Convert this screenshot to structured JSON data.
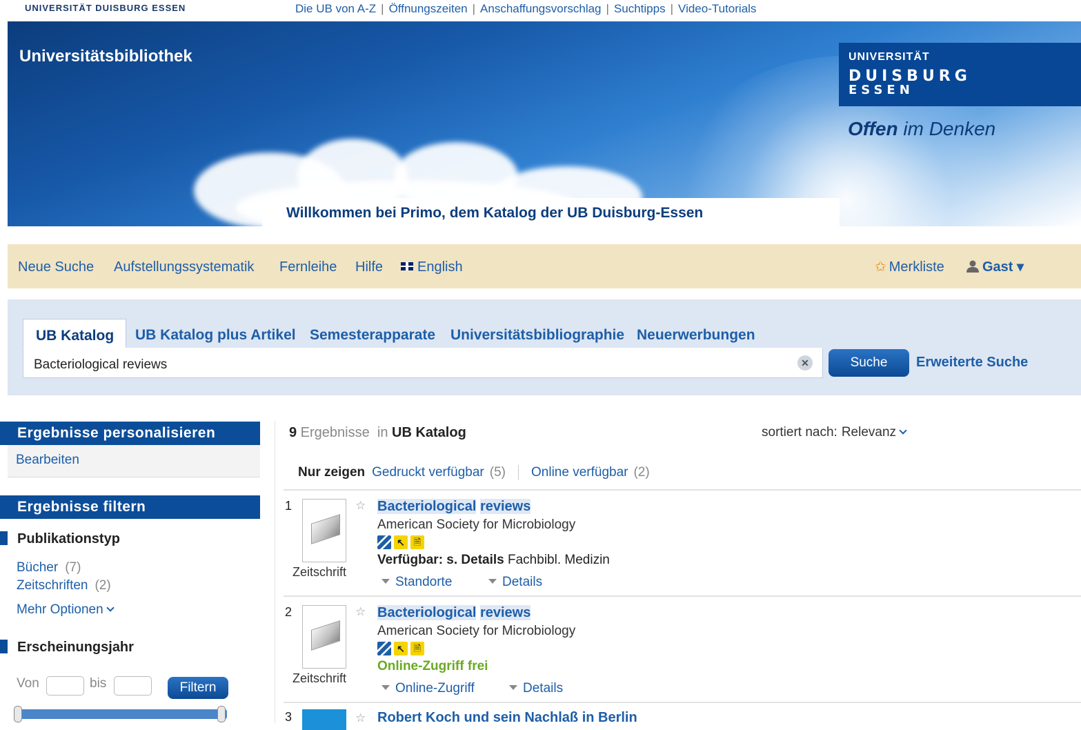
{
  "top": {
    "uni_small": "UNIVERSITÄT DUISBURG ESSEN",
    "links": [
      "Die UB von A-Z",
      "Öffnungszeiten",
      "Anschaffungsvorschlag",
      "Suchtipps",
      "Video-Tutorials"
    ]
  },
  "banner": {
    "title": "Universitätsbibliothek",
    "logo_line1": "UNIVERSITÄT",
    "logo_line2": "DUISBURG",
    "logo_line3": "ESSEN",
    "slogan_bold": "Offen",
    "slogan_rest": " im Denken",
    "welcome": "Willkommen bei Primo, dem Katalog der UB Duisburg-Essen"
  },
  "nav": {
    "items": [
      "Neue Suche",
      "Aufstellungssystematik",
      "Fernleihe",
      "Hilfe",
      "English"
    ],
    "merkliste": "Merkliste",
    "user": "Gast ▾"
  },
  "search": {
    "tabs": [
      "UB Katalog",
      "UB Katalog plus Artikel",
      "Semesterapparate",
      "Universitätsbibliographie",
      "Neuerwerbungen"
    ],
    "value": "Bacteriological reviews",
    "clear": "✕",
    "button": "Suche",
    "advanced": "Erweiterte Suche"
  },
  "left": {
    "personalize_head": "Ergebnisse personalisieren",
    "edit": "Bearbeiten",
    "filter_head": "Ergebnisse filtern",
    "pubtype_head": "Publikationstyp",
    "facets": [
      {
        "label": "Bücher",
        "count": "(7)"
      },
      {
        "label": "Zeitschriften",
        "count": "(2)"
      }
    ],
    "more": "Mehr Optionen",
    "year_head": "Erscheinungsjahr",
    "from": "Von",
    "to": "bis",
    "filter_btn": "Filtern"
  },
  "results": {
    "count": "9",
    "count_label": " Ergebnisse",
    "in_label": "in",
    "scope": "UB Katalog",
    "sort_label": "sortiert nach:",
    "sort_value": "Relevanz",
    "only_label": "Nur zeigen",
    "only_printed": "Gedruckt verfügbar",
    "only_printed_count": "(5)",
    "only_online": "Online verfügbar",
    "only_online_count": "(2)",
    "records": [
      {
        "num": "1",
        "type": "Zeitschrift",
        "title_a": "Bacteriological",
        "title_b": "reviews",
        "author": "American Society for Microbiology",
        "avail_bold": "Verfügbar: s. Details",
        "avail_rest": " Fachbibl. Medizin",
        "link1": "Standorte",
        "link2": "Details"
      },
      {
        "num": "2",
        "type": "Zeitschrift",
        "title_a": "Bacteriological",
        "title_b": "reviews",
        "author": "American Society for Microbiology",
        "avail_free": "Online-Zugriff frei",
        "link1": "Online-Zugriff",
        "link2": "Details"
      },
      {
        "num": "3",
        "title": "Robert Koch und sein Nachlaß in Berlin"
      }
    ]
  }
}
